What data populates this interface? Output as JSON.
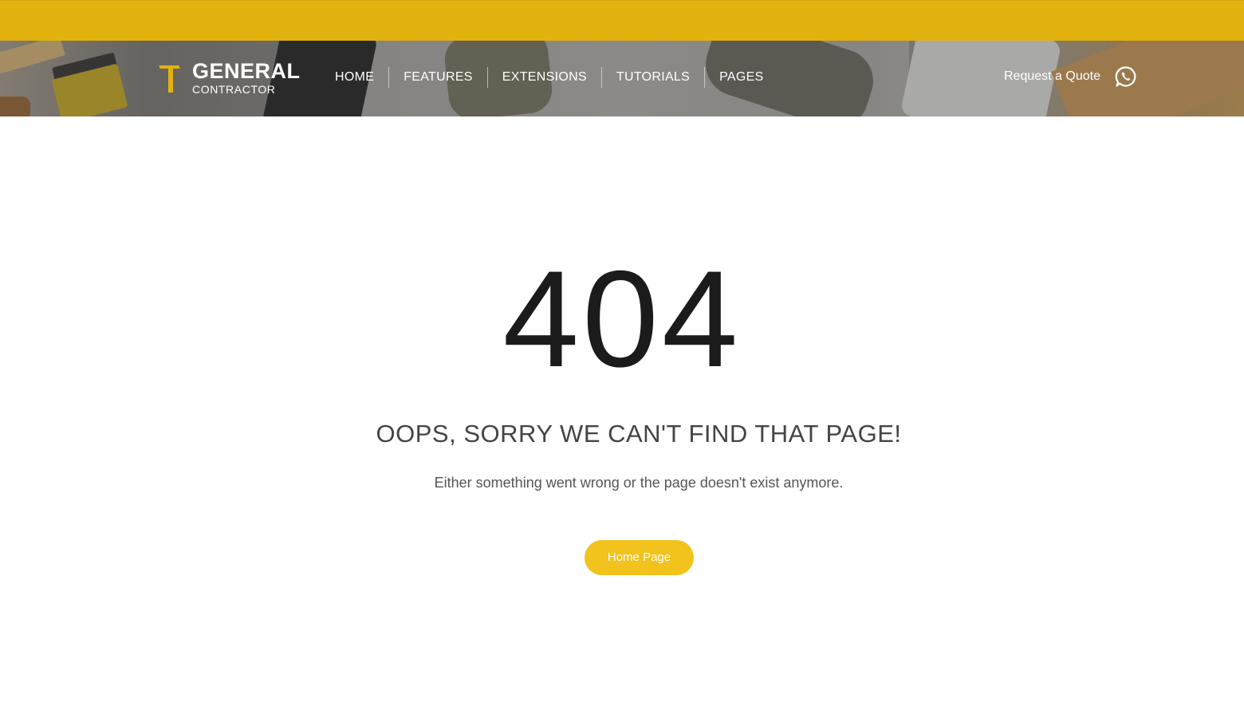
{
  "brand": {
    "name": "GENERAL",
    "tagline": "CONTRACTOR",
    "logo_icon": "hammer-icon"
  },
  "nav": {
    "items": [
      {
        "label": "HOME"
      },
      {
        "label": "FEATURES"
      },
      {
        "label": "EXTENSIONS"
      },
      {
        "label": "TUTORIALS"
      },
      {
        "label": "PAGES"
      }
    ]
  },
  "header_actions": {
    "quote_label": "Request a Quote",
    "contact_icon": "whatsapp-icon"
  },
  "error": {
    "code": "404",
    "title": "OOPS, SORRY WE CAN'T FIND THAT PAGE!",
    "message": "Either something went wrong or the page doesn't exist anymore.",
    "button_label": "Home Page"
  },
  "colors": {
    "accent": "#e2b30f",
    "button": "#f1c31c",
    "heading": "#1b1b1b"
  }
}
